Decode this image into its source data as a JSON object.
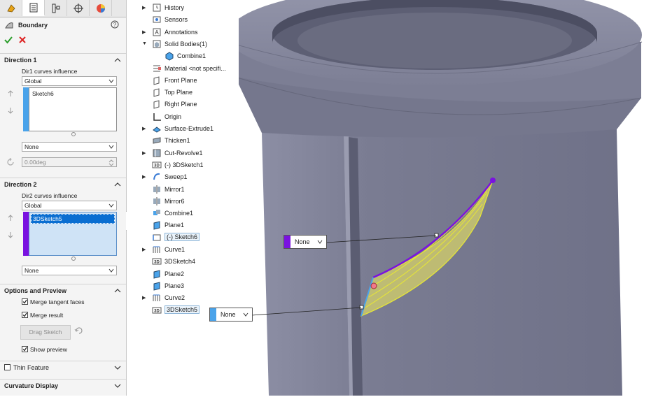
{
  "pm": {
    "tabs": [
      "feature-manager-tab",
      "property-manager-tab",
      "configuration-manager-tab",
      "dimxpert-tab",
      "appearance-tab"
    ],
    "title": "Boundary",
    "direction1": {
      "header": "Direction 1",
      "influence_label": "Dir1 curves influence",
      "influence_value": "Global",
      "items": [
        "Sketch6"
      ],
      "tangency_value": "None",
      "angle_value": "0.00deg",
      "color": "#4aa3ea"
    },
    "direction2": {
      "header": "Direction 2",
      "influence_label": "Dir2 curves influence",
      "influence_value": "Global",
      "items": [
        "3DSketch5"
      ],
      "tangency_value": "None",
      "color": "#7a12e0"
    },
    "options": {
      "header": "Options and Preview",
      "merge_tangent": "Merge tangent faces",
      "merge_result": "Merge result",
      "drag_sketch": "Drag Sketch",
      "show_preview": "Show preview"
    },
    "thin_feature": "Thin Feature",
    "curvature_display": "Curvature Display"
  },
  "tree": [
    {
      "label": "History",
      "icon": "history-icon",
      "expand": true,
      "indent": 0
    },
    {
      "label": "Sensors",
      "icon": "sensor-icon",
      "expand": false,
      "indent": 0
    },
    {
      "label": "Annotations",
      "icon": "annotation-icon",
      "expand": true,
      "indent": 0
    },
    {
      "label": "Solid Bodies(1)",
      "icon": "solid-bodies-icon",
      "expand": "open",
      "indent": 0
    },
    {
      "label": "Combine1",
      "icon": "body-icon",
      "expand": false,
      "indent": 1
    },
    {
      "label": "Material <not specifi...",
      "icon": "material-icon",
      "expand": false,
      "indent": 0
    },
    {
      "label": "Front Plane",
      "icon": "plane-icon",
      "expand": false,
      "indent": 0
    },
    {
      "label": "Top Plane",
      "icon": "plane-icon",
      "expand": false,
      "indent": 0
    },
    {
      "label": "Right Plane",
      "icon": "plane-icon",
      "expand": false,
      "indent": 0
    },
    {
      "label": "Origin",
      "icon": "origin-icon",
      "expand": false,
      "indent": 0
    },
    {
      "label": "Surface-Extrude1",
      "icon": "surface-extrude-icon",
      "expand": true,
      "indent": 0
    },
    {
      "label": "Thicken1",
      "icon": "thicken-icon",
      "expand": false,
      "indent": 0
    },
    {
      "label": "Cut-Revolve1",
      "icon": "cut-revolve-icon",
      "expand": true,
      "indent": 0
    },
    {
      "label": "(-) 3DSketch1",
      "icon": "3dsketch-icon",
      "expand": false,
      "indent": 0
    },
    {
      "label": "Sweep1",
      "icon": "sweep-icon",
      "expand": true,
      "indent": 0
    },
    {
      "label": "Mirror1",
      "icon": "mirror-icon",
      "expand": false,
      "indent": 0
    },
    {
      "label": "Mirror6",
      "icon": "mirror-icon",
      "expand": false,
      "indent": 0
    },
    {
      "label": "Combine1",
      "icon": "combine-icon",
      "expand": false,
      "indent": 0
    },
    {
      "label": "Plane1",
      "icon": "plane-feature-icon",
      "expand": false,
      "indent": 0
    },
    {
      "label": "(-) Sketch6",
      "icon": "sketch-icon",
      "expand": false,
      "indent": 0,
      "highlight": true
    },
    {
      "label": "Curve1",
      "icon": "curve-icon",
      "expand": true,
      "indent": 0
    },
    {
      "label": "3DSketch4",
      "icon": "3dsketch-icon",
      "expand": false,
      "indent": 0
    },
    {
      "label": "Plane2",
      "icon": "plane-feature-icon",
      "expand": false,
      "indent": 0
    },
    {
      "label": "Plane3",
      "icon": "plane-feature-icon",
      "expand": false,
      "indent": 0
    },
    {
      "label": "Curve2",
      "icon": "curve-icon",
      "expand": true,
      "indent": 0
    },
    {
      "label": "3DSketch5",
      "icon": "3dsketch-icon",
      "expand": false,
      "indent": 0,
      "highlight": true
    }
  ],
  "viewport": {
    "callout_top": {
      "label": "None",
      "color": "#7a12e0"
    },
    "callout_bottom": {
      "label": "None",
      "color": "#4aa3ea"
    }
  }
}
